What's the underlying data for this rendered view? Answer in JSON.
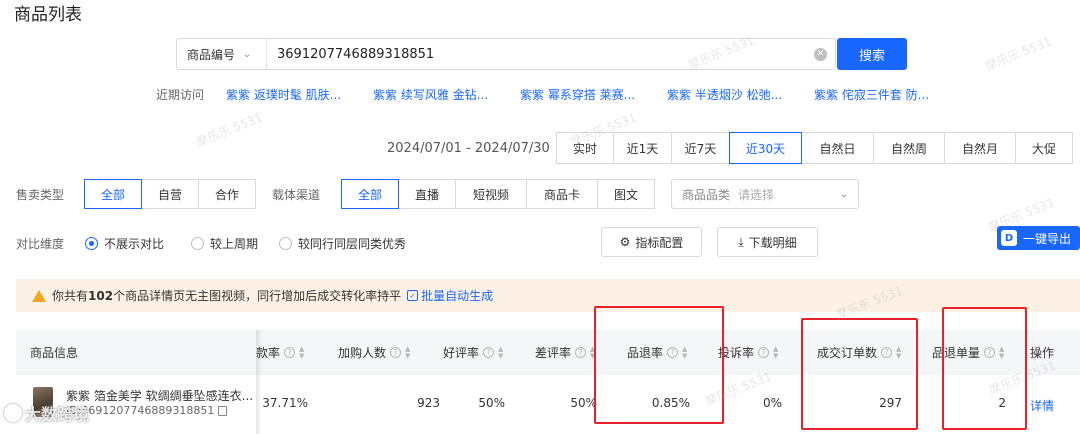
{
  "page": {
    "title": "商品列表"
  },
  "search": {
    "field_label": "商品编号",
    "value": "3691207746889318851",
    "button_label": "搜索"
  },
  "recent": {
    "label": "近期访问",
    "items": [
      "紫紫 返璞时髦 肌肤...",
      "紫紫 续写风雅 金钻...",
      "紫紫 幂系穿搭 莱赛...",
      "紫紫 半透烟沙 松弛...",
      "紫紫 侘寂三件套 防..."
    ]
  },
  "date": {
    "range": "2024/07/01 - 2024/07/30",
    "options": [
      "实时",
      "近1天",
      "近7天",
      "近30天",
      "自然日",
      "自然周",
      "自然月",
      "大促"
    ],
    "active": "近30天"
  },
  "filters": {
    "sale_type_label": "售卖类型",
    "sale_types": [
      "全部",
      "自营",
      "合作"
    ],
    "channel_label": "载体渠道",
    "channels": [
      "全部",
      "直播",
      "短视频",
      "商品卡",
      "图文"
    ],
    "category_label": "商品品类",
    "category_placeholder": "请选择"
  },
  "compare": {
    "label": "对比维度",
    "options": [
      "不展示对比",
      "较上周期",
      "较同行同层同类优秀"
    ],
    "selected": "不展示对比",
    "metric_config_label": "指标配置",
    "download_label": "下载明细",
    "export_label": "一键导出"
  },
  "notice": {
    "prefix": "你共有",
    "count": "102",
    "suffix": "个商品详情页无主图视频，同行增加后成交转化率持平",
    "link_label": "批量自动生成"
  },
  "table": {
    "columns": [
      "商品信息",
      "款率",
      "加购人数",
      "好评率",
      "差评率",
      "品退率",
      "投诉率",
      "成交订单数",
      "品退单量",
      "操作"
    ],
    "rows": [
      {
        "product_name": "紫紫 箔金美学 软绸绸垂坠感连衣...",
        "product_id": "ID:3691207746889318851",
        "rate": "37.71%",
        "cart_users": "923",
        "good_rate": "50%",
        "bad_rate": "50%",
        "return_rate": "0.85%",
        "complaint_rate": "0%",
        "orders": "297",
        "return_orders": "2",
        "action": "详情"
      }
    ]
  },
  "watermark": {
    "text": "摩乐乐 5531",
    "brand": "大数跨境"
  },
  "colors": {
    "accent": "#1967ff",
    "annotation": "#e8222a",
    "notice_bg": "#fdf1e5",
    "warn": "#f5a623"
  }
}
